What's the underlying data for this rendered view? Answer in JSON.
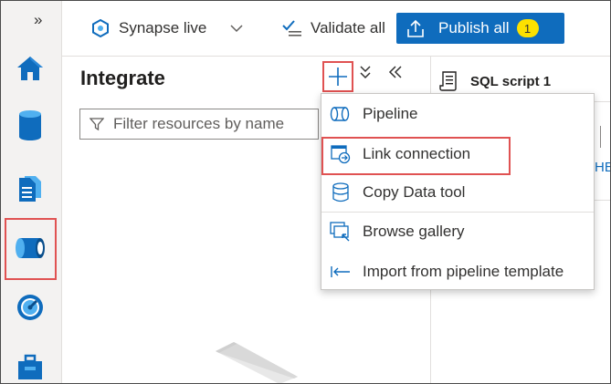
{
  "topbar": {
    "workspace_mode": "Synapse live",
    "validate_label": "Validate all",
    "publish_label": "Publish all",
    "publish_count": "1"
  },
  "rail": {
    "items": [
      {
        "name": "home-icon",
        "selected": false
      },
      {
        "name": "data-icon",
        "selected": false
      },
      {
        "name": "develop-icon",
        "selected": false
      },
      {
        "name": "integrate-icon",
        "selected": true
      },
      {
        "name": "monitor-icon",
        "selected": false
      },
      {
        "name": "manage-icon",
        "selected": false
      }
    ]
  },
  "panel": {
    "title": "Integrate",
    "filter_placeholder": "Filter resources by name"
  },
  "add_menu": {
    "items": [
      {
        "label": "Pipeline",
        "icon": "pipeline-icon"
      },
      {
        "label": "Link connection",
        "icon": "link-connection-icon"
      },
      {
        "label": "Copy Data tool",
        "icon": "copy-data-icon"
      },
      {
        "label": "Browse gallery",
        "icon": "gallery-icon"
      },
      {
        "label": "Import from pipeline template",
        "icon": "import-icon"
      }
    ]
  },
  "editor": {
    "tab_title": "SQL script 1",
    "partial_text": "HE"
  },
  "colors": {
    "accent": "#0f6cbd",
    "highlight": "#e05252",
    "badge": "#fce100"
  }
}
